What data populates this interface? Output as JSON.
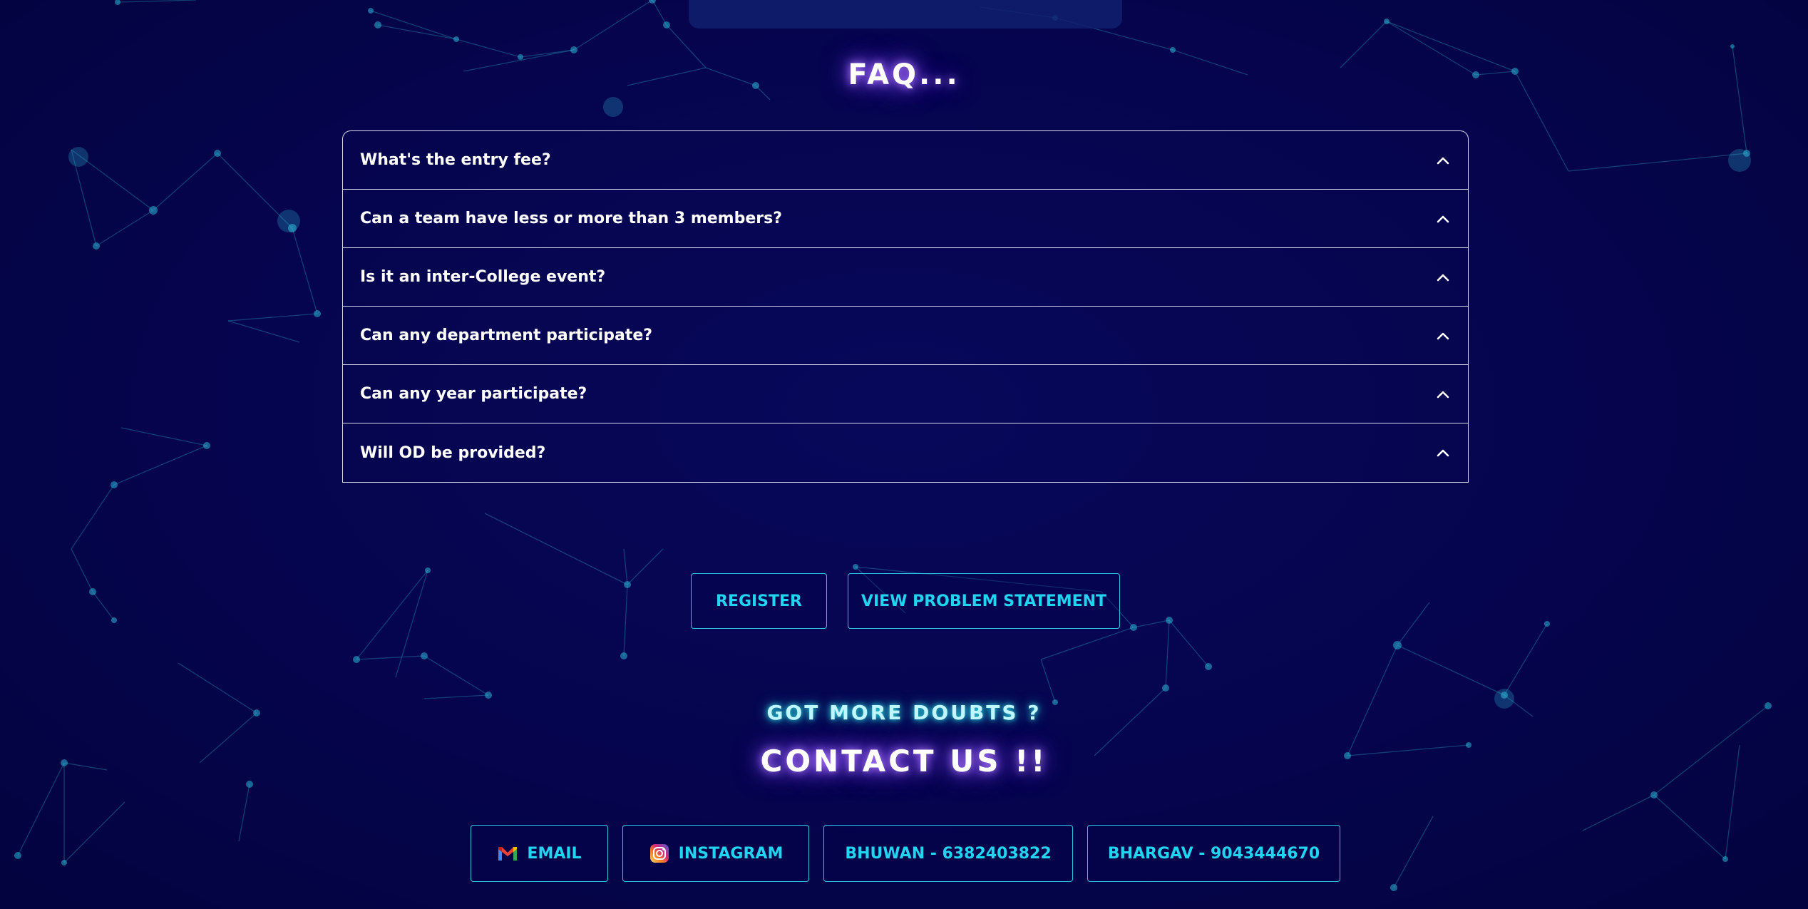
{
  "faq": {
    "heading": "FAQ...",
    "items": [
      {
        "question": "What's the entry fee?"
      },
      {
        "question": "Can a team have less or more than 3 members?"
      },
      {
        "question": "Is it an inter-College event?"
      },
      {
        "question": "Can any department participate?"
      },
      {
        "question": "Can any year participate?"
      },
      {
        "question": "Will OD be provided?"
      }
    ],
    "toggle_icon": "chevron-up-icon"
  },
  "actions": {
    "register_label": "REGISTER",
    "problem_label": "VIEW PROBLEM STATEMENT"
  },
  "contact": {
    "subheading": "GOT MORE DOUBTS ?",
    "heading": "CONTACT US !!",
    "email_label": "EMAIL",
    "instagram_label": "INSTAGRAM",
    "bhuwan_label": "BHUWAN - 6382403822",
    "bhargav_label": "BHARGAV - 9043444670"
  },
  "colors": {
    "background": "#04034a",
    "accent": "#21d4f0",
    "heading_glow": "#8a4dff",
    "text": "#ffffff"
  }
}
